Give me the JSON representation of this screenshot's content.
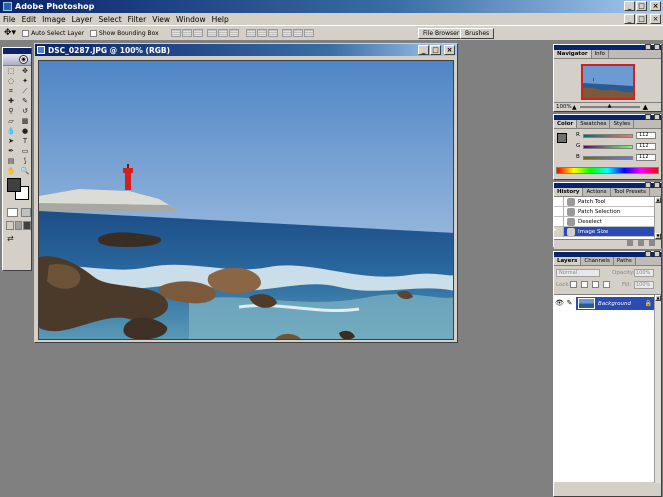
{
  "app": {
    "title": "Adobe Photoshop"
  },
  "window_controls": {
    "minimize": "_",
    "maximize": "□",
    "close": "×"
  },
  "menu": [
    "File",
    "Edit",
    "Image",
    "Layer",
    "Select",
    "Filter",
    "View",
    "Window",
    "Help"
  ],
  "options_bar": {
    "auto_select_layer": {
      "label": "Auto Select Layer",
      "checked": false
    },
    "show_bounding_box": {
      "label": "Show Bounding Box",
      "checked": false
    },
    "file_browser": "File Browser",
    "brushes": "Brushes"
  },
  "document": {
    "title": "DSC_0287.JPG @ 100% (RGB)",
    "colors": {
      "sky_top": "#4f86c6",
      "sky_bottom": "#bdd2ea",
      "sea": "#1d4e86",
      "lighthouse": "#d41f1f"
    }
  },
  "navigator": {
    "tabs": [
      "Navigator",
      "Info"
    ],
    "zoom": "100%"
  },
  "color_panel": {
    "tabs": [
      "Color",
      "Swatches",
      "Styles"
    ],
    "channels": [
      {
        "label": "R",
        "value": "112"
      },
      {
        "label": "G",
        "value": "112"
      },
      {
        "label": "B",
        "value": "112"
      }
    ]
  },
  "history": {
    "tabs": [
      "History",
      "Actions",
      "Tool Presets"
    ],
    "items": [
      {
        "label": "Patch Tool",
        "selected": false
      },
      {
        "label": "Patch Selection",
        "selected": false
      },
      {
        "label": "Deselect",
        "selected": false
      },
      {
        "label": "Image Size",
        "selected": true
      }
    ]
  },
  "layers": {
    "tabs": [
      "Layers",
      "Channels",
      "Paths"
    ],
    "blend_mode": "Normal",
    "opacity_label": "Opacity:",
    "opacity": "100%",
    "lock_label": "Lock:",
    "fill_label": "Fill:",
    "fill": "100%",
    "items": [
      {
        "name": "Background",
        "selected": true
      }
    ]
  }
}
